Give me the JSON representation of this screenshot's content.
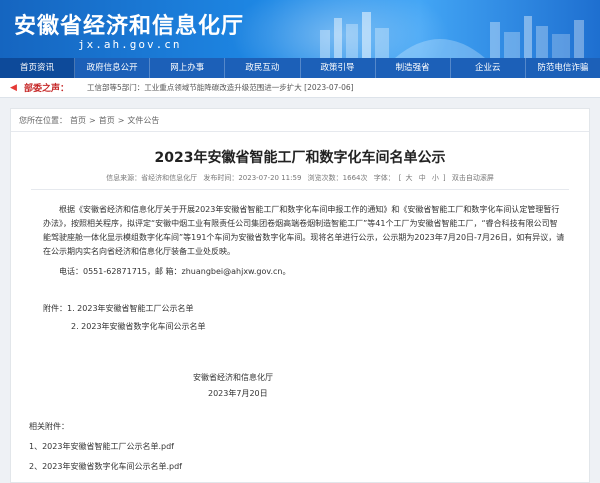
{
  "header": {
    "site_title": "安徽省经济和信息化厅",
    "site_domain": "jx.ah.gov.cn"
  },
  "nav": {
    "items": [
      "首页资讯",
      "政府信息公开",
      "网上办事",
      "政民互动",
      "政策引导",
      "制造强省",
      "企业云",
      "防范电信诈骗"
    ]
  },
  "ticker": {
    "label": "部委之声：",
    "text": "工信部等5部门：工业重点领域节能降碳改造升级范围进一步扩大 [2023-07-06]"
  },
  "breadcrumb": {
    "prefix": "您所在位置：",
    "home": "首页",
    "sep1": ">",
    "section": "首页",
    "sep2": ">",
    "current": "文件公告"
  },
  "article": {
    "title": "2023年安徽省智能工厂和数字化车间名单公示",
    "meta": {
      "source": "信息来源：省经济和信息化厅",
      "published": "发布时间：2023-07-20 11:59",
      "views": "浏览次数：1664次",
      "font_label": "字体：",
      "font_large": "大",
      "font_medium": "中",
      "font_small": "小",
      "read_aloud": "双击自动滚屏"
    },
    "body_p1": "根据《安徽省经济和信息化厅关于开展2023年安徽省智能工厂和数字化车间申报工作的通知》和《安徽省智能工厂和数字化车间认定管理暂行办法》，按照相关程序，拟评定“安徽中烟工业有限责任公司集团卷烟高端卷烟制造智能工厂”等41个工厂为安徽省智能工厂，“睿合科技有限公司智能驾驶座舱一体化显示模组数字化车间”等191个车间为安徽省数字化车间。现将名单进行公示，公示期为2023年7月20日-7月26日，如有异议，请在公示期内实名向省经济和信息化厅装备工业处反映。",
    "body_p2": "电话：0551-62871715，邮 箱：zhuangbei@ahjxw.gov.cn。",
    "attachments_intro": "附件：1. 2023年安徽省智能工厂公示名单",
    "attachments_second": "2. 2023年安徽省数字化车间公示名单",
    "signature_org": "安徽省经济和信息化厅",
    "signature_date": "2023年7月20日",
    "related_label": "相关附件：",
    "file1": "1、2023年安徽省智能工厂公示名单.pdf",
    "file2": "2、2023年安徽省数字化车间公示名单.pdf"
  },
  "colors": {
    "nav_bg": "#1c60b8",
    "banner_start": "#1565c0",
    "ticker_label": "#c62828"
  }
}
